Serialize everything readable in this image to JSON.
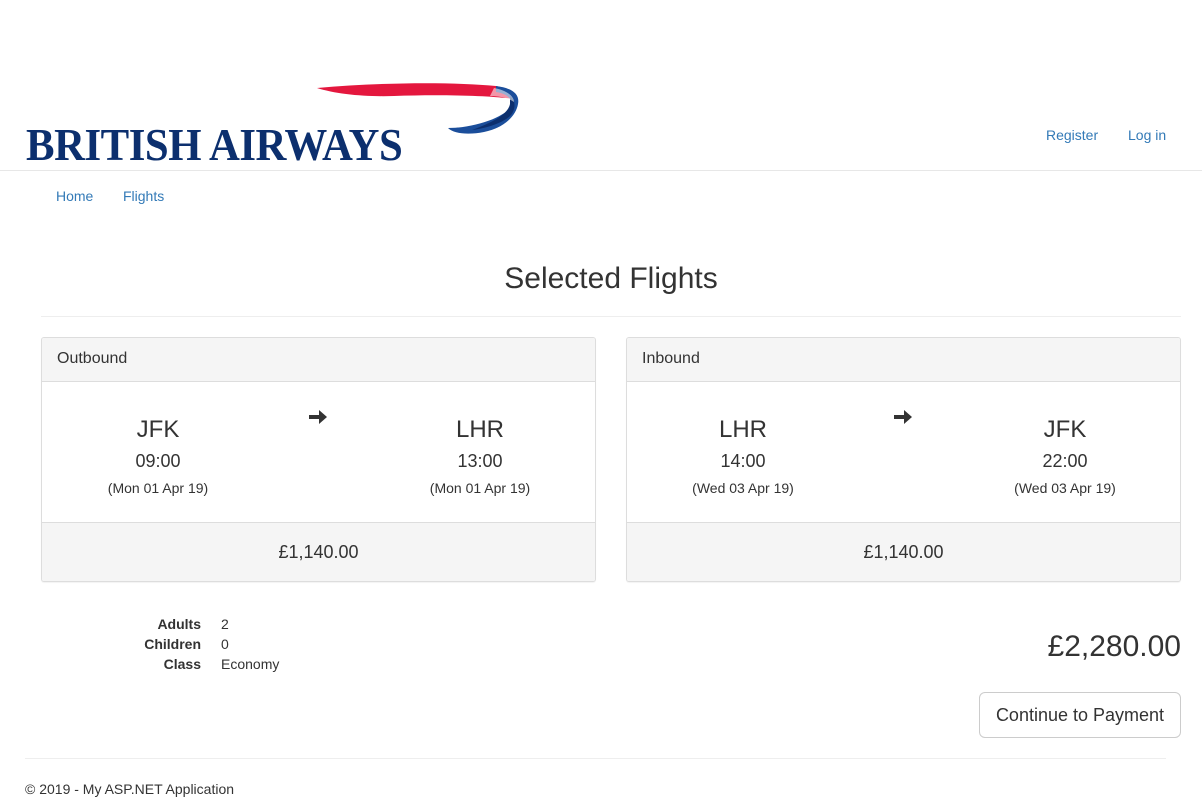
{
  "header": {
    "logo_text": "BRITISH AIRWAYS",
    "register_label": "Register",
    "login_label": "Log in"
  },
  "nav": {
    "home_label": "Home",
    "flights_label": "Flights"
  },
  "page": {
    "title": "Selected Flights"
  },
  "outbound": {
    "heading": "Outbound",
    "from": {
      "code": "JFK",
      "time": "09:00",
      "date": "(Mon 01 Apr 19)"
    },
    "to": {
      "code": "LHR",
      "time": "13:00",
      "date": "(Mon 01 Apr 19)"
    },
    "price": "£1,140.00"
  },
  "inbound": {
    "heading": "Inbound",
    "from": {
      "code": "LHR",
      "time": "14:00",
      "date": "(Wed 03 Apr 19)"
    },
    "to": {
      "code": "JFK",
      "time": "22:00",
      "date": "(Wed 03 Apr 19)"
    },
    "price": "£1,140.00"
  },
  "summary": {
    "adults_label": "Adults",
    "adults_value": "2",
    "children_label": "Children",
    "children_value": "0",
    "class_label": "Class",
    "class_value": "Economy",
    "total": "£2,280.00",
    "continue_label": "Continue to Payment"
  },
  "footer": {
    "text": "© 2019 - My ASP.NET Application"
  },
  "colors": {
    "link": "#337ab7",
    "brand_blue": "#0c2f6e",
    "brand_red": "#e4173e",
    "panel_bg": "#f5f5f5"
  },
  "icons": {
    "leg_arrow": "arrow-right-icon",
    "logo_swoosh": "speedmarque-icon"
  }
}
